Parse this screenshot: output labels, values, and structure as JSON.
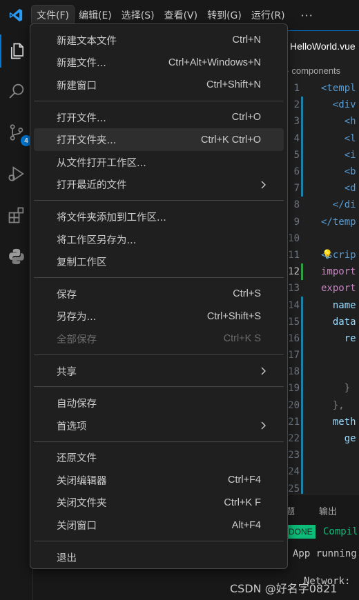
{
  "menubar": {
    "items": [
      "文件(F)",
      "编辑(E)",
      "选择(S)",
      "查看(V)",
      "转到(G)",
      "运行(R)"
    ],
    "more": "···"
  },
  "activity": {
    "scm_badge": "4"
  },
  "editor": {
    "tab_title": "HelloWorld.vue",
    "breadcrumb": "components",
    "lines": [
      {
        "n": "1",
        "text": "<templ"
      },
      {
        "n": "2",
        "text": "  <div"
      },
      {
        "n": "3",
        "text": "    <h"
      },
      {
        "n": "4",
        "text": "    <l"
      },
      {
        "n": "5",
        "text": "    <i"
      },
      {
        "n": "6",
        "text": "    <b"
      },
      {
        "n": "7",
        "text": "    <d"
      },
      {
        "n": "8",
        "text": "  </di"
      },
      {
        "n": "9",
        "text": "</temp"
      },
      {
        "n": "10",
        "text": ""
      },
      {
        "n": "11",
        "text": "<scrip"
      },
      {
        "n": "12",
        "text": "import"
      },
      {
        "n": "13",
        "text": "export"
      },
      {
        "n": "14",
        "text": "  name"
      },
      {
        "n": "15",
        "text": "  data"
      },
      {
        "n": "16",
        "text": "    re"
      },
      {
        "n": "17",
        "text": ""
      },
      {
        "n": "18",
        "text": ""
      },
      {
        "n": "19",
        "text": "    }"
      },
      {
        "n": "20",
        "text": "  },"
      },
      {
        "n": "21",
        "text": "  meth"
      },
      {
        "n": "22",
        "text": "    ge"
      },
      {
        "n": "23",
        "text": ""
      },
      {
        "n": "24",
        "text": ""
      },
      {
        "n": "25",
        "text": ""
      }
    ]
  },
  "panel": {
    "tab_problems": "题",
    "tab_output": "输出",
    "done_badge": "DONE",
    "compile_text": "Compil",
    "app_running": "App running",
    "network": "Network:"
  },
  "watermark": "CSDN @好名字0821",
  "file_menu": {
    "groups": [
      [
        {
          "label": "新建文本文件",
          "shortcut": "Ctrl+N"
        },
        {
          "label": "新建文件...",
          "shortcut": "Ctrl+Alt+Windows+N"
        },
        {
          "label": "新建窗口",
          "shortcut": "Ctrl+Shift+N"
        }
      ],
      [
        {
          "label": "打开文件...",
          "shortcut": "Ctrl+O"
        },
        {
          "label": "打开文件夹...",
          "shortcut": "Ctrl+K Ctrl+O"
        },
        {
          "label": "从文件打开工作区...",
          "shortcut": ""
        },
        {
          "label": "打开最近的文件",
          "shortcut": ""
        }
      ],
      [
        {
          "label": "将文件夹添加到工作区...",
          "shortcut": ""
        },
        {
          "label": "将工作区另存为...",
          "shortcut": ""
        },
        {
          "label": "复制工作区",
          "shortcut": ""
        }
      ],
      [
        {
          "label": "保存",
          "shortcut": "Ctrl+S"
        },
        {
          "label": "另存为...",
          "shortcut": "Ctrl+Shift+S"
        },
        {
          "label": "全部保存",
          "shortcut": "Ctrl+K S"
        }
      ],
      [
        {
          "label": "共享",
          "shortcut": ""
        }
      ],
      [
        {
          "label": "自动保存",
          "shortcut": ""
        },
        {
          "label": "首选项",
          "shortcut": ""
        }
      ],
      [
        {
          "label": "还原文件",
          "shortcut": ""
        },
        {
          "label": "关闭编辑器",
          "shortcut": "Ctrl+F4"
        },
        {
          "label": "关闭文件夹",
          "shortcut": "Ctrl+K F"
        },
        {
          "label": "关闭窗口",
          "shortcut": "Alt+F4"
        }
      ],
      [
        {
          "label": "退出",
          "shortcut": ""
        }
      ]
    ]
  },
  "colors": {
    "accent": "#0078d4",
    "menu_bg": "#1f1f1f",
    "hover_bg": "#2e2e2e",
    "done_green": "#0dbc79"
  }
}
